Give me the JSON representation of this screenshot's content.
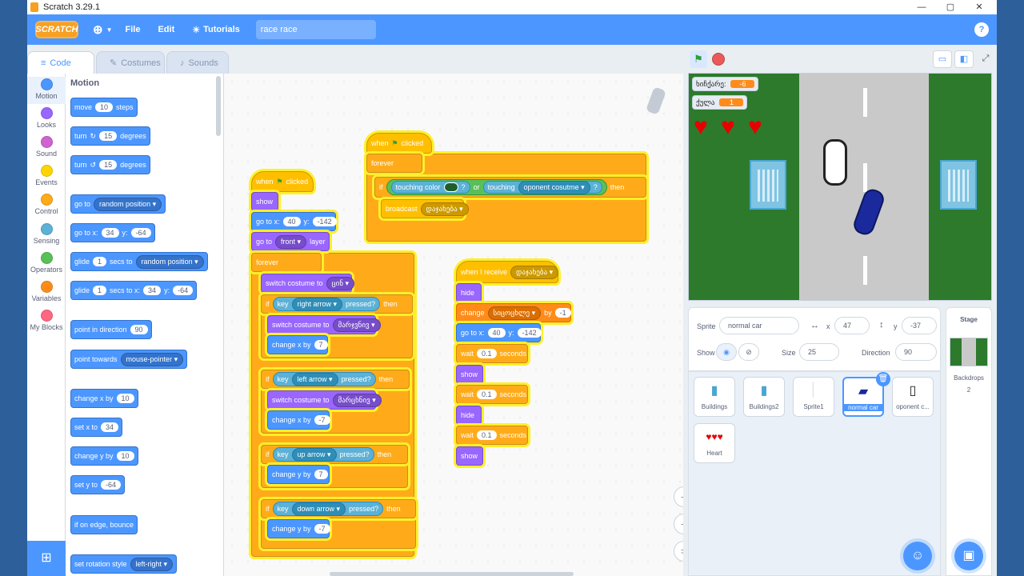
{
  "window": {
    "title": "Scratch 3.29.1",
    "minimize": "—",
    "maximize": "▢",
    "close": "✕"
  },
  "menubar": {
    "logo": "SCRATCH",
    "file": "File",
    "edit": "Edit",
    "tutorials": "Tutorials",
    "project_title": "race race",
    "help": "?"
  },
  "tabs": {
    "code": "Code",
    "costumes": "Costumes",
    "sounds": "Sounds"
  },
  "categories": [
    {
      "label": "Motion",
      "color": "#4c97ff"
    },
    {
      "label": "Looks",
      "color": "#9966ff"
    },
    {
      "label": "Sound",
      "color": "#cf63cf"
    },
    {
      "label": "Events",
      "color": "#ffd500"
    },
    {
      "label": "Control",
      "color": "#ffab19"
    },
    {
      "label": "Sensing",
      "color": "#5cb1d6"
    },
    {
      "label": "Operators",
      "color": "#59c059"
    },
    {
      "label": "Variables",
      "color": "#ff8c1a"
    },
    {
      "label": "My Blocks",
      "color": "#ff6680"
    }
  ],
  "palette": {
    "heading": "Motion",
    "move": {
      "a": "move",
      "n": "10",
      "b": "steps"
    },
    "turn_cw": {
      "a": "turn",
      "n": "15",
      "b": "degrees"
    },
    "turn_ccw": {
      "a": "turn",
      "n": "15",
      "b": "degrees"
    },
    "goto": {
      "a": "go to",
      "d": "random position"
    },
    "gotoxy": {
      "a": "go to x:",
      "x": "34",
      "y_label": "y:",
      "y": "-64"
    },
    "glide1": {
      "a": "glide",
      "n": "1",
      "b": "secs to",
      "d": "random position"
    },
    "glide2": {
      "a": "glide",
      "n": "1",
      "b": "secs to x:",
      "x": "34",
      "y_label": "y:",
      "y": "-64"
    },
    "point_dir": {
      "a": "point in direction",
      "n": "90"
    },
    "point_towards": {
      "a": "point towards",
      "d": "mouse-pointer"
    },
    "change_x": {
      "a": "change x by",
      "n": "10"
    },
    "set_x": {
      "a": "set x to",
      "n": "34"
    },
    "change_y": {
      "a": "change y by",
      "n": "10"
    },
    "set_y": {
      "a": "set y to",
      "n": "-64"
    },
    "bounce": "if on edge, bounce",
    "rotation": {
      "a": "set rotation style",
      "d": "left-right"
    }
  },
  "script1": {
    "hat": "when",
    "hat2": "clicked",
    "show": "show",
    "goto": {
      "a": "go to x:",
      "x": "40",
      "yl": "y:",
      "y": "-142"
    },
    "front": {
      "a": "go to",
      "d": "front",
      "b": "layer"
    },
    "forever": "forever",
    "switch1": {
      "a": "switch costume to",
      "d": "ცინ"
    },
    "if1": {
      "if": "if",
      "key": "key",
      "d": "right arrow",
      "pressed": "pressed?",
      "then": "then"
    },
    "switch2": {
      "a": "switch costume to",
      "d": "მარჯვნივ"
    },
    "chx1": {
      "a": "change x by",
      "n": "7"
    },
    "if2": {
      "if": "if",
      "key": "key",
      "d": "left arrow",
      "pressed": "pressed?",
      "then": "then"
    },
    "switch3": {
      "a": "switch costume to",
      "d": "მარცხნივ"
    },
    "chx2": {
      "a": "change x by",
      "n": "-7"
    },
    "if3": {
      "if": "if",
      "key": "key",
      "d": "up arrow",
      "pressed": "pressed?",
      "then": "then"
    },
    "chy1": {
      "a": "change y by",
      "n": "7"
    },
    "if4": {
      "if": "if",
      "key": "key",
      "d": "down arrow",
      "pressed": "pressed?",
      "then": "then"
    },
    "chy2": {
      "a": "change y by",
      "n": "-7"
    }
  },
  "script2": {
    "hat": "when",
    "hat2": "clicked",
    "forever": "forever",
    "if": "if",
    "touching_color": "touching color",
    "q": "?",
    "or": "or",
    "touching": "touching",
    "d": "oponent cosutme",
    "q2": "?",
    "then": "then",
    "broadcast": {
      "a": "broadcast",
      "d": "დაჯახება"
    }
  },
  "script3": {
    "hat": {
      "a": "when I receive",
      "d": "დაჯახება"
    },
    "hide1": "hide",
    "change": {
      "a": "change",
      "d": "სიცოცხლე",
      "b": "by",
      "n": "-1"
    },
    "goto": {
      "a": "go to x:",
      "x": "40",
      "yl": "y:",
      "y": "-142"
    },
    "wait1": {
      "a": "wait",
      "n": "0.1",
      "b": "seconds"
    },
    "show1": "show",
    "wait2": {
      "a": "wait",
      "n": "0.1",
      "b": "seconds"
    },
    "hide2": "hide",
    "wait3": {
      "a": "wait",
      "n": "0.1",
      "b": "seconds"
    },
    "show2": "show"
  },
  "stage": {
    "monitor1": {
      "label": "ხიჩქარე:",
      "value": "-6"
    },
    "monitor2": {
      "label": "ქულა",
      "value": "1"
    },
    "hearts": "♥"
  },
  "sprite_info": {
    "sprite_label": "Sprite",
    "sprite_name": "normal car",
    "x_label": "x",
    "x": "47",
    "y_label": "y",
    "y": "-37",
    "show_label": "Show",
    "size_label": "Size",
    "size": "25",
    "direction_label": "Direction",
    "direction": "90"
  },
  "sprites": [
    {
      "name": "Buildings"
    },
    {
      "name": "Buildings2"
    },
    {
      "name": "Sprite1"
    },
    {
      "name": "normal car"
    },
    {
      "name": "oponent c..."
    },
    {
      "name": "Heart"
    }
  ],
  "stage_pane": {
    "title": "Stage",
    "backdrops_label": "Backdrops",
    "backdrops_count": "2"
  }
}
